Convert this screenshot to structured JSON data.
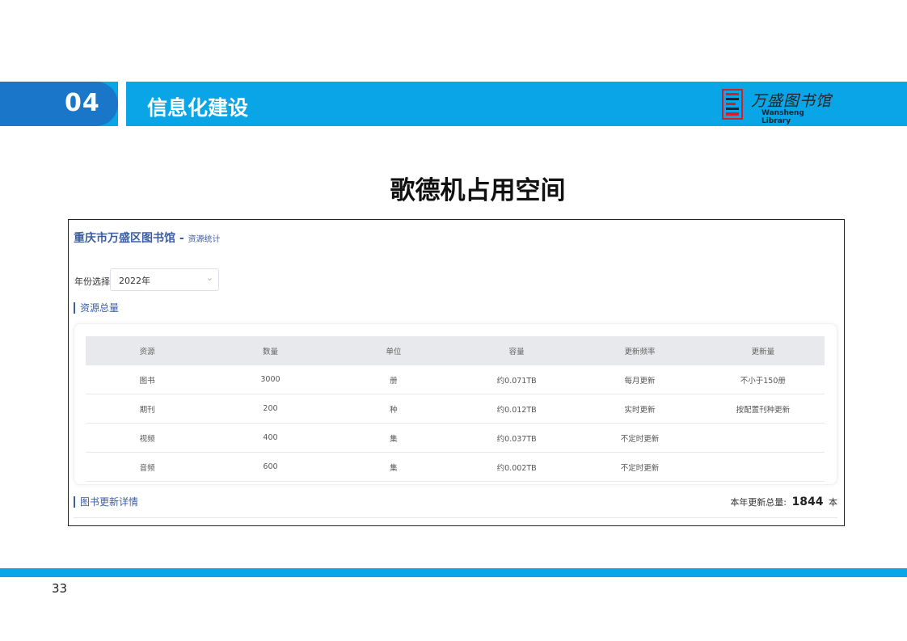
{
  "header": {
    "section_number": "04",
    "section_title": "信息化建设",
    "logo": {
      "cn_text": "万盛图书馆",
      "en_text": "Wansheng Library",
      "mark": "library-seal-icon"
    }
  },
  "heading": "歌德机占用空间",
  "app": {
    "title": "重庆市万盛区图书馆 -",
    "subtitle": "资源统计",
    "year_label": "年份选择:",
    "year_value": "2022年",
    "section_resources": "资源总量",
    "table": {
      "columns": [
        "资源",
        "数量",
        "单位",
        "容量",
        "更新频率",
        "更新量"
      ],
      "rows": [
        [
          "图书",
          "3000",
          "册",
          "约0.071TB",
          "每月更新",
          "不小于150册"
        ],
        [
          "期刊",
          "200",
          "种",
          "约0.012TB",
          "实时更新",
          "按配置刊种更新"
        ],
        [
          "视频",
          "400",
          "集",
          "约0.037TB",
          "不定时更新",
          ""
        ],
        [
          "音频",
          "600",
          "集",
          "约0.002TB",
          "不定时更新",
          ""
        ]
      ]
    },
    "section_books": "图书更新详情",
    "total_label": "本年更新总量:",
    "total_value": "1844",
    "total_unit": "本"
  },
  "page_number": "33",
  "colors": {
    "accent_blue": "#0aa5e6",
    "dark_blue": "#1a76c8",
    "link_blue": "#3a5da8"
  }
}
